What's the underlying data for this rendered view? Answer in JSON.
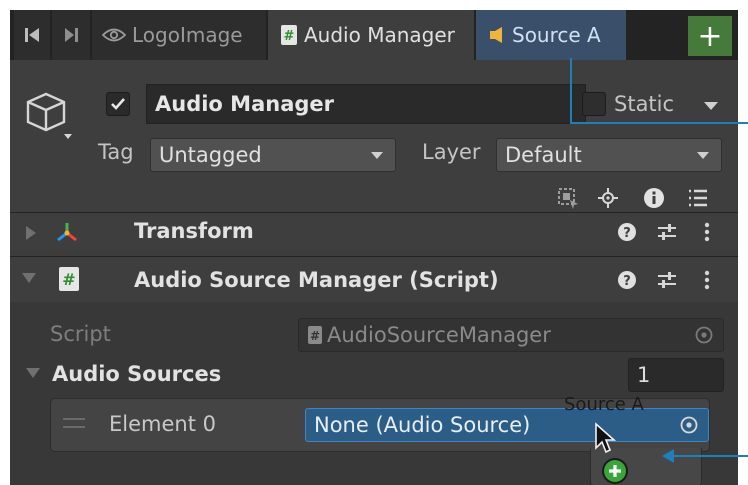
{
  "tabs": {
    "first_icon": "skip-to-first-icon",
    "prev_icon": "skip-back-icon",
    "items": [
      {
        "label": "LogoImage",
        "icon": "eye-icon"
      },
      {
        "label": "Audio Manager",
        "icon": "script-icon"
      },
      {
        "label": "Source A",
        "icon": "audio-source-icon"
      }
    ],
    "add_icon": "plus-icon"
  },
  "header": {
    "object_name": "Audio Manager",
    "active": true,
    "static_label": "Static",
    "tag_label": "Tag",
    "tag_value": "Untagged",
    "layer_label": "Layer",
    "layer_value": "Default"
  },
  "components": {
    "transform": {
      "title": "Transform"
    },
    "script": {
      "title": "Audio Source Manager (Script)"
    }
  },
  "fields": {
    "script_label": "Script",
    "script_value": "AudioSourceManager",
    "list_label": "Audio Sources",
    "list_size": "1",
    "element_label": "Element 0",
    "element_value": "None (Audio Source)",
    "drag_label": "Source A"
  },
  "colors": {
    "accent_blue": "#1f7fb8",
    "selection": "#2c5d87",
    "add_green": "#3aa53a"
  }
}
